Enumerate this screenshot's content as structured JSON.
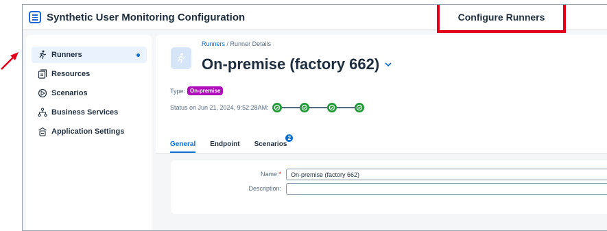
{
  "app": {
    "title": "Synthetic User Monitoring Configuration"
  },
  "callout": {
    "label": "Configure Runners",
    "border_color": "#e3001b"
  },
  "sidebar": {
    "items": [
      {
        "label": "Runners",
        "icon": "runner-icon",
        "selected": true
      },
      {
        "label": "Resources",
        "icon": "resources-icon"
      },
      {
        "label": "Scenarios",
        "icon": "scenarios-icon"
      },
      {
        "label": "Business Services",
        "icon": "business-services-icon"
      },
      {
        "label": "Application Settings",
        "icon": "application-settings-icon"
      }
    ]
  },
  "breadcrumb": {
    "parent": "Runners",
    "separator": " / ",
    "current": "Runner Details"
  },
  "object": {
    "title": "On-premise (factory 662)",
    "type_label": "Type:",
    "type_value": "On-premise",
    "status_label": "Status on Jun 21, 2024, 9:52:28AM:",
    "status_steps": 4
  },
  "tabs": [
    {
      "label": "General",
      "active": true
    },
    {
      "label": "Endpoint"
    },
    {
      "label": "Scenarios",
      "badge": "2"
    }
  ],
  "form": {
    "name_label": "Name:",
    "required_marker": "*",
    "name_value": "On-premise (factory 662)",
    "description_label": "Description:",
    "description_value": ""
  },
  "colors": {
    "accent": "#0a6ed1",
    "type_badge": "#b00dbd",
    "status_success": "#1f9a38",
    "arrow": "#e3001b"
  }
}
